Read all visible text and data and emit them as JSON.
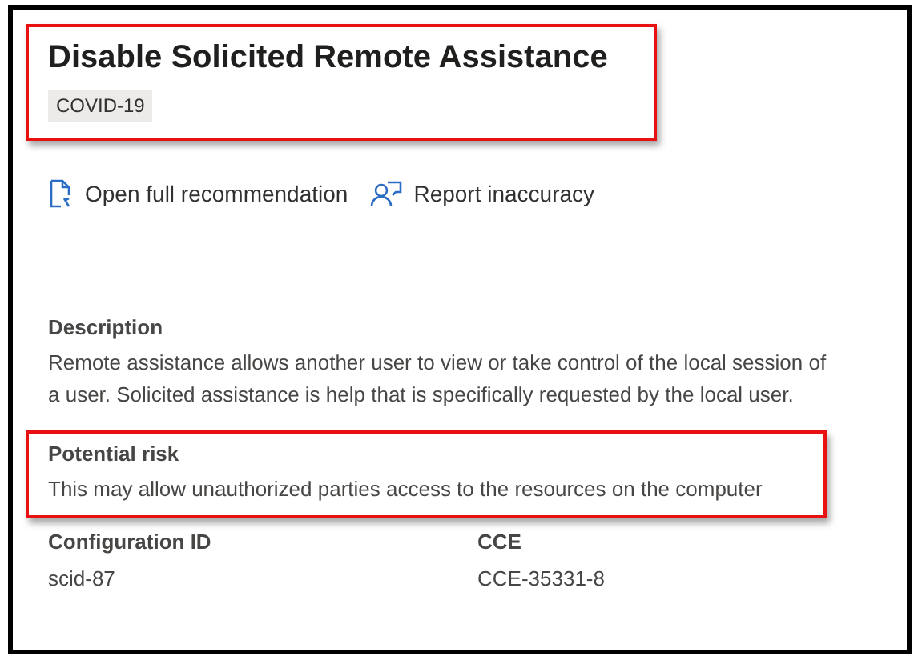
{
  "header": {
    "title": "Disable Solicited Remote Assistance",
    "tag": "COVID-19",
    "highlighted": true
  },
  "actions": [
    {
      "kind": "document",
      "label": "Open full recommendation"
    },
    {
      "kind": "person",
      "label": "Report inaccuracy"
    }
  ],
  "sections": [
    {
      "heading": "Description",
      "text": "Remote assistance allows another user to view or take control of the local session of a user. Solicited assistance is help that is specifically requested by the local user.",
      "highlighted": false
    },
    {
      "heading": "Potential risk",
      "text": "This may allow unauthorized parties access to the resources on the computer",
      "highlighted": true
    }
  ],
  "fields": [
    {
      "label": "Configuration ID",
      "value": "scid-87"
    },
    {
      "label": "CCE",
      "value": "CCE-35331-8"
    }
  ]
}
